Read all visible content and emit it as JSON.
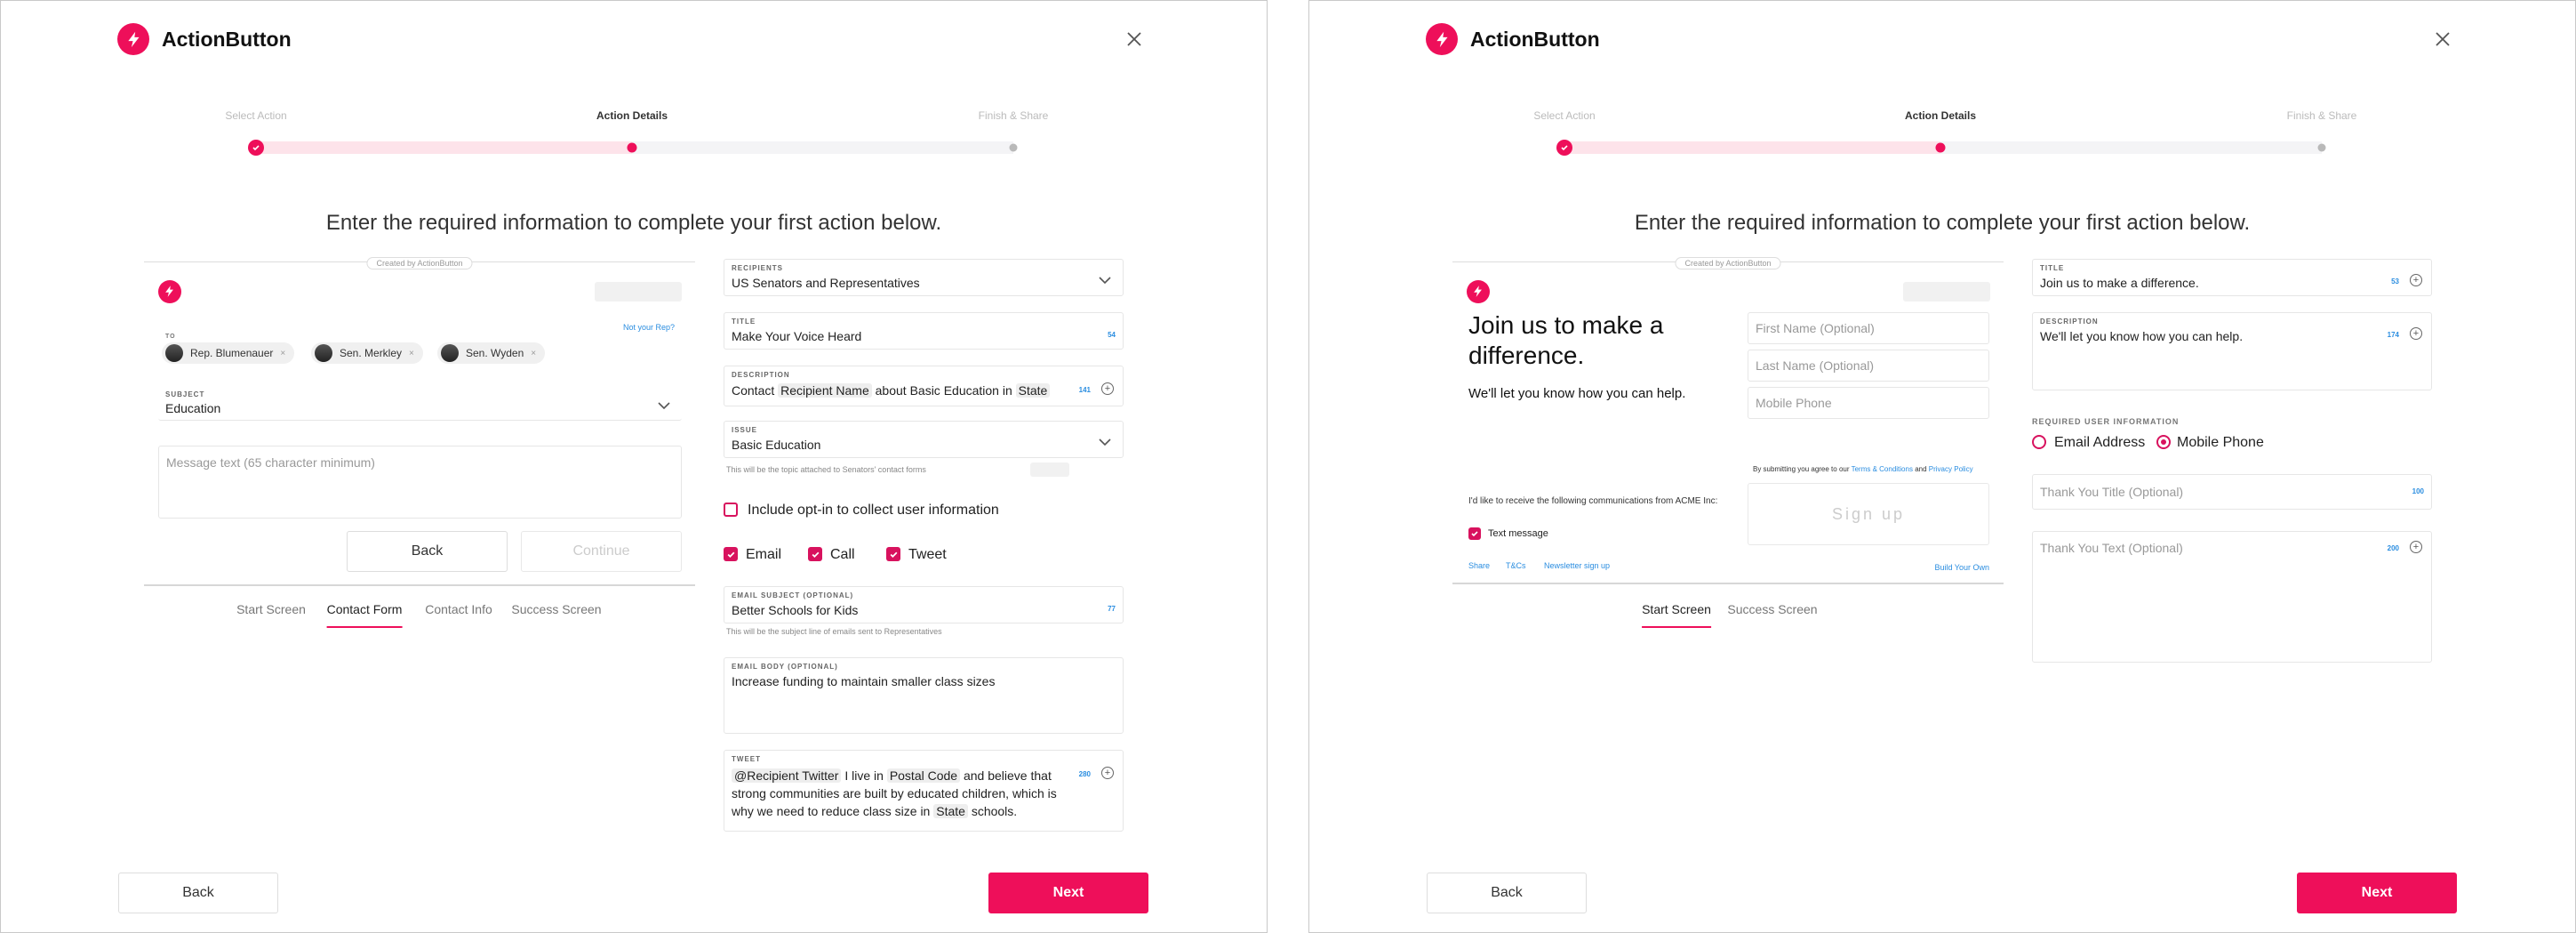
{
  "brand": "ActionButton",
  "colors": {
    "accent": "#ee0f5a",
    "link": "#2a8de0"
  },
  "stepper": {
    "steps": [
      "Select Action",
      "Action Details",
      "Finish & Share"
    ],
    "active_index": 1
  },
  "headline": "Enter the required information to complete your first action below.",
  "footer": {
    "back_label": "Back",
    "next_label": "Next"
  },
  "left": {
    "preview": {
      "created_by": "Created by ActionButton",
      "not_your_rep": "Not your Rep?",
      "to_label": "TO",
      "recipients": [
        "Rep. Blumenauer",
        "Sen. Merkley",
        "Sen. Wyden"
      ],
      "subject_label": "SUBJECT",
      "subject_value": "Education",
      "message_placeholder": "Message text (65 character minimum)",
      "back_label": "Back",
      "continue_label": "Continue"
    },
    "tabs": [
      "Start Screen",
      "Contact Form",
      "Contact Info",
      "Success Screen"
    ],
    "active_tab": "Contact Form",
    "form": {
      "recipients": {
        "label": "RECIPIENTS",
        "value": "US Senators and Representatives"
      },
      "title": {
        "label": "TITLE",
        "value": "Make Your Voice Heard",
        "count": "54"
      },
      "description": {
        "label": "DESCRIPTION",
        "parts": [
          "Contact",
          "Recipient Name",
          "about Basic Education in",
          "State"
        ],
        "count": "141"
      },
      "issue": {
        "label": "ISSUE",
        "value": "Basic Education",
        "hint": "This will be the topic attached to Senators' contact forms"
      },
      "optin_label": "Include opt-in to collect user information",
      "channels": [
        "Email",
        "Call",
        "Tweet"
      ],
      "email_subject": {
        "label": "EMAIL SUBJECT (OPTIONAL)",
        "value": "Better Schools for Kids",
        "count": "77",
        "hint": "This will be the subject line of emails sent to Representatives"
      },
      "email_body": {
        "label": "EMAIL BODY (OPTIONAL)",
        "value": "Increase funding to maintain smaller class sizes"
      },
      "tweet": {
        "label": "TWEET",
        "line1": [
          "@Recipient Twitter",
          "I live in",
          "Postal Code",
          "and believe that"
        ],
        "line2": "strong communities are built by educated children, which is",
        "line3": [
          "why we need to reduce class size in",
          "State",
          "schools."
        ],
        "count": "280"
      }
    }
  },
  "right": {
    "preview": {
      "created_by": "Created by ActionButton",
      "title": "Join us to make a difference.",
      "subtitle": "We'll let you know how you can help.",
      "first_name_placeholder": "First Name (Optional)",
      "last_name_placeholder": "Last Name (Optional)",
      "mobile_placeholder": "Mobile Phone",
      "terms_prefix": "By submitting you agree to our",
      "terms_link": "Terms & Conditions",
      "terms_and": "and",
      "privacy_link": "Privacy Policy",
      "consent_text": "I'd like to receive the following communications from ACME Inc:",
      "text_message_label": "Text message",
      "signup_label": "Sign up",
      "links": [
        "Share",
        "T&Cs",
        "Newsletter sign up"
      ],
      "build_your_own": "Build Your Own"
    },
    "tabs": [
      "Start Screen",
      "Success Screen"
    ],
    "active_tab": "Start Screen",
    "form": {
      "title": {
        "label": "TITLE",
        "value": "Join us to make a difference.",
        "count": "53"
      },
      "description": {
        "label": "DESCRIPTION",
        "value": "We'll let you know how you can help.",
        "count": "174"
      },
      "required_label": "REQUIRED USER INFORMATION",
      "options": [
        "Email Address",
        "Mobile Phone"
      ],
      "selected_option": "Mobile Phone",
      "thank_title_placeholder": "Thank You Title (Optional)",
      "thank_title_count": "100",
      "thank_text_placeholder": "Thank You Text (Optional)",
      "thank_text_count": "200"
    }
  }
}
